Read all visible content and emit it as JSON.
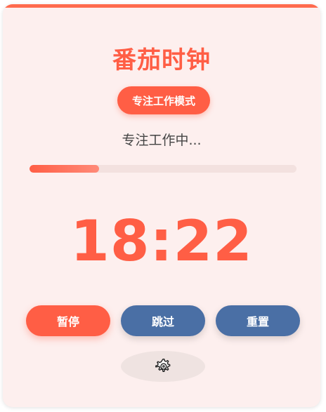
{
  "app": {
    "title": "番茄时钟",
    "mode_label": "专注工作模式",
    "status_text": "专注工作中..."
  },
  "timer": {
    "display": "18:22",
    "progress_fraction": 0.26
  },
  "controls": {
    "pause_label": "暂停",
    "skip_label": "跳过",
    "reset_label": "重置",
    "settings_icon": "gear-icon"
  },
  "colors": {
    "accent": "#ff5e45",
    "secondary": "#4a6fa5",
    "background": "#fdefee"
  }
}
